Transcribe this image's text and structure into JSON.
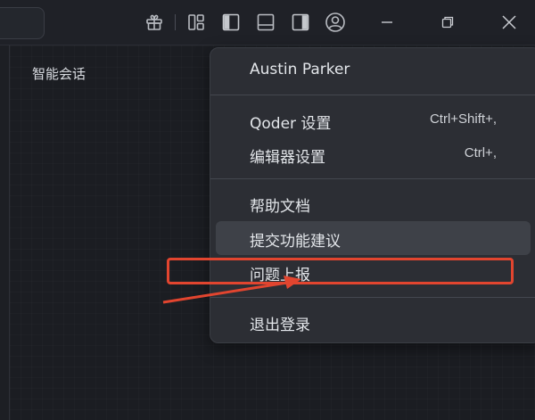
{
  "panel": {
    "title": "智能会话"
  },
  "titlebar": {
    "icons": [
      "gift-icon",
      "layout-grid-icon",
      "toggle-left-sidebar-icon",
      "toggle-bottom-panel-icon",
      "toggle-right-sidebar-icon",
      "account-icon"
    ],
    "window_controls": [
      "minimize-icon",
      "restore-icon",
      "close-icon"
    ]
  },
  "menu": {
    "user_name": "Austin Parker",
    "items": [
      {
        "label": "Qoder 设置",
        "shortcut": "Ctrl+Shift+,"
      },
      {
        "label": "编辑器设置",
        "shortcut": "Ctrl+,"
      },
      {
        "label": "帮助文档",
        "shortcut": ""
      },
      {
        "label": "提交功能建议",
        "shortcut": ""
      },
      {
        "label": "问题上报",
        "shortcut": ""
      },
      {
        "label": "退出登录",
        "shortcut": ""
      }
    ]
  },
  "colors": {
    "background": "#1b1d22",
    "menu_background": "#2c2e34",
    "menu_hover": "#3e4148",
    "annotation_red": "#e2452f"
  }
}
